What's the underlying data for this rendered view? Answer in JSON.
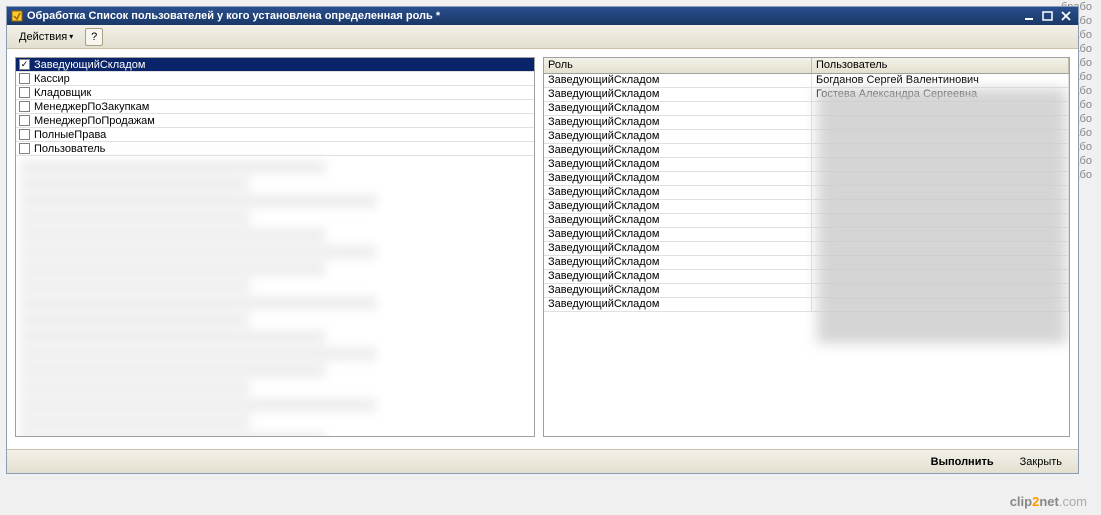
{
  "window": {
    "title": "Обработка  Список пользователей у кого установлена определенная роль *"
  },
  "toolbar": {
    "actions_label": "Действия",
    "help_label": "?"
  },
  "roles": [
    {
      "label": "ЗаведующийСкладом",
      "checked": true,
      "selected": true
    },
    {
      "label": "Кассир",
      "checked": false,
      "selected": false
    },
    {
      "label": "Кладовщик",
      "checked": false,
      "selected": false
    },
    {
      "label": "МенеджерПоЗакупкам",
      "checked": false,
      "selected": false
    },
    {
      "label": "МенеджерПоПродажам",
      "checked": false,
      "selected": false
    },
    {
      "label": "ПолныеПрава",
      "checked": false,
      "selected": false
    },
    {
      "label": "Пользователь",
      "checked": false,
      "selected": false
    }
  ],
  "grid": {
    "header_role": "Роль",
    "header_user": "Пользователь",
    "rows": [
      {
        "role": "ЗаведующийСкладом",
        "user": "Богданов Сергей Валентинович"
      },
      {
        "role": "ЗаведующийСкладом",
        "user": "Гостева Александра Сергеевна"
      },
      {
        "role": "ЗаведующийСкладом",
        "user": ""
      },
      {
        "role": "ЗаведующийСкладом",
        "user": ""
      },
      {
        "role": "ЗаведующийСкладом",
        "user": ""
      },
      {
        "role": "ЗаведующийСкладом",
        "user": ""
      },
      {
        "role": "ЗаведующийСкладом",
        "user": ""
      },
      {
        "role": "ЗаведующийСкладом",
        "user": ""
      },
      {
        "role": "ЗаведующийСкладом",
        "user": ""
      },
      {
        "role": "ЗаведующийСкладом",
        "user": ""
      },
      {
        "role": "ЗаведующийСкладом",
        "user": ""
      },
      {
        "role": "ЗаведующийСкладом",
        "user": ""
      },
      {
        "role": "ЗаведующийСкладом",
        "user": ""
      },
      {
        "role": "ЗаведующийСкладом",
        "user": ""
      },
      {
        "role": "ЗаведующийСкладом",
        "user": ""
      },
      {
        "role": "ЗаведующийСкладом",
        "user": ""
      },
      {
        "role": "ЗаведующийСкладом",
        "user": ""
      }
    ]
  },
  "footer": {
    "execute_label": "Выполнить",
    "close_label": "Закрыть"
  },
  "background_text": "брабо",
  "watermark": {
    "p1": "clip",
    "p2": "2",
    "p3": "net",
    "p4": ".com"
  }
}
